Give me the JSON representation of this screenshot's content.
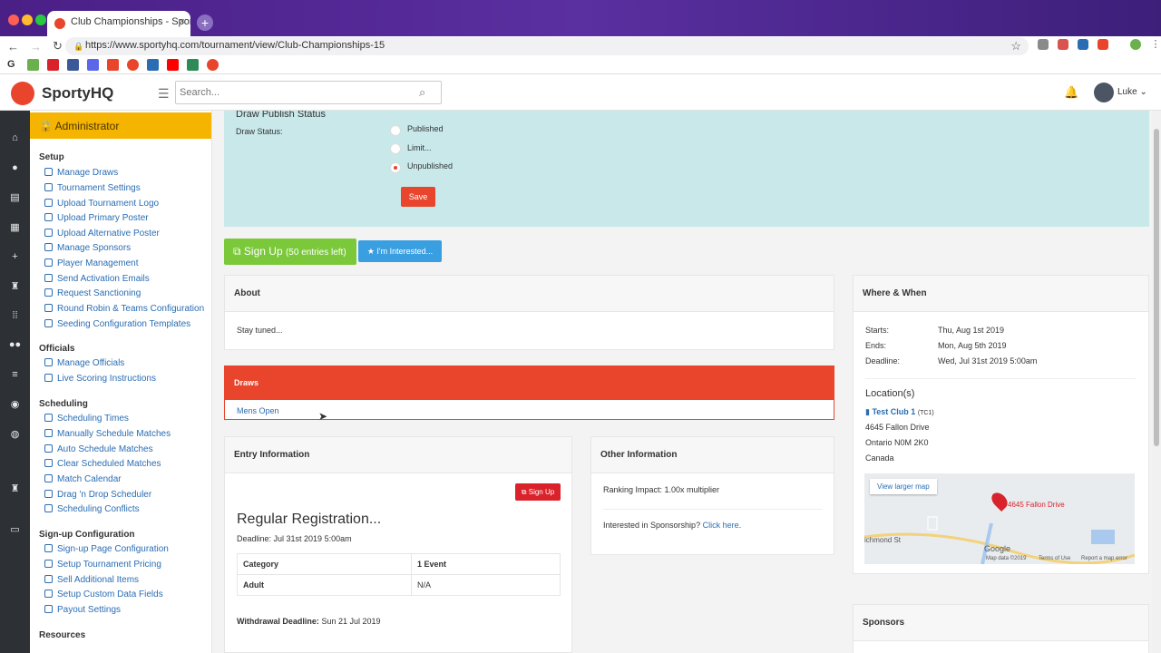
{
  "browser": {
    "tab_title": "Club Championships - SportyH",
    "url": "https://www.sportyhq.com/tournament/view/Club-Championships-15",
    "new_tab_label": "+",
    "close_label": "×"
  },
  "header": {
    "brand": "SportyHQ",
    "search_placeholder": "Search...",
    "user_name": "Luke"
  },
  "sidebar": {
    "admin_label": "Administrator",
    "sections": [
      {
        "title": "Setup",
        "items": [
          "Manage Draws",
          "Tournament Settings",
          "Upload Tournament Logo",
          "Upload Primary Poster",
          "Upload Alternative Poster",
          "Manage Sponsors",
          "Player Management",
          "Send Activation Emails",
          "Request Sanctioning",
          "Round Robin & Teams Configuration",
          "Seeding Configuration Templates"
        ]
      },
      {
        "title": "Officials",
        "items": [
          "Manage Officials",
          "Live Scoring Instructions"
        ]
      },
      {
        "title": "Scheduling",
        "items": [
          "Scheduling Times",
          "Manually Schedule Matches",
          "Auto Schedule Matches",
          "Clear Scheduled Matches",
          "Match Calendar",
          "Drag 'n Drop Scheduler",
          "Scheduling Conflicts"
        ]
      },
      {
        "title": "Sign-up Configuration",
        "items": [
          "Sign-up Page Configuration",
          "Setup Tournament Pricing",
          "Sell Additional Items",
          "Setup Custom Data Fields",
          "Payout Settings"
        ]
      },
      {
        "title": "Resources",
        "items": []
      }
    ]
  },
  "publish": {
    "heading": "Draw Publish Status",
    "field_label": "Draw Status:",
    "options": [
      "Published",
      "Limit...",
      "Unpublished"
    ],
    "selected": "Unpublished",
    "save_label": "Save"
  },
  "actions": {
    "signup_label": "Sign Up",
    "signup_entries": "(50 entries left)",
    "interested_label": "I'm Interested..."
  },
  "about": {
    "title": "About",
    "text": "Stay tuned..."
  },
  "draws": {
    "title": "Draws",
    "items": [
      "Mens Open"
    ]
  },
  "entry": {
    "title": "Entry Information",
    "signup_btn": "Sign Up",
    "reg_title": "Regular Registration...",
    "deadline": "Deadline: Jul 31st 2019 5:00am",
    "table": [
      [
        "Category",
        "1 Event"
      ],
      [
        "Adult",
        "N/A"
      ]
    ],
    "withdrawal_label": "Withdrawal Deadline:",
    "withdrawal_value": "Sun 21 Jul 2019"
  },
  "other": {
    "title": "Other Information",
    "ranking": "Ranking Impact: 1.00x multiplier",
    "sponsor_text": "Interested in Sponsorship?",
    "sponsor_link": "Click here",
    "sponsor_end": "."
  },
  "where": {
    "title": "Where & When",
    "rows": [
      [
        "Starts:",
        "Thu, Aug 1st 2019"
      ],
      [
        "Ends:",
        "Mon, Aug 5th 2019"
      ],
      [
        "Deadline:",
        "Wed, Jul 31st 2019 5:00am"
      ]
    ],
    "location_title": "Location(s)",
    "club": "Test Club 1",
    "club_code": "(TC1)",
    "address": [
      "4645 Fallon Drive",
      "Ontario N0M 2K0",
      "Canada"
    ],
    "map_button": "View larger map",
    "map_pin_label": "4645 Fallon Drive",
    "map_street": "ichmond St",
    "map_google": "Google",
    "map_footer": [
      "Map data ©2019",
      "Terms of Use",
      "Report a map error"
    ]
  },
  "sponsors": {
    "title": "Sponsors"
  },
  "colors": {
    "accent": "#e8452c",
    "admin": "#f5b400",
    "signup": "#7bc93a",
    "info": "#3a9fe0",
    "publish_bg": "#c8e8ea"
  }
}
